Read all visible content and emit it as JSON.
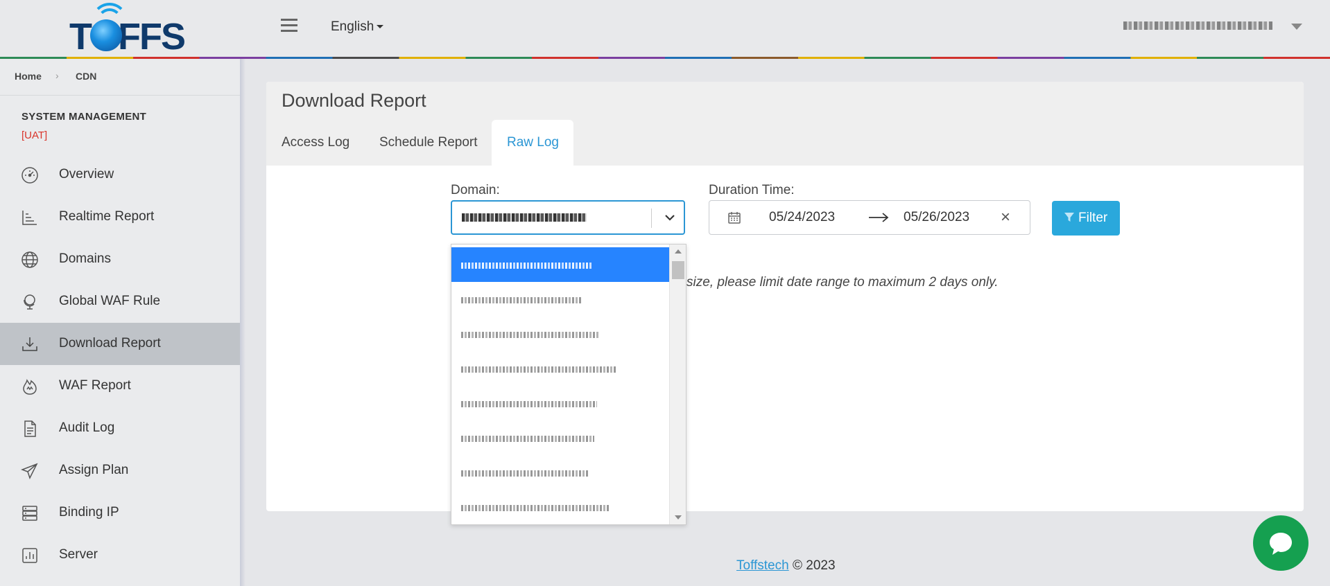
{
  "header": {
    "logo_text": "TOFFS",
    "language": "English"
  },
  "breadcrumb": {
    "home": "Home",
    "current": "CDN"
  },
  "sidebar": {
    "title": "SYSTEM MANAGEMENT",
    "env": "[UAT]",
    "items": [
      {
        "label": "Overview",
        "icon": "gauge-icon"
      },
      {
        "label": "Realtime Report",
        "icon": "bar-chart-icon"
      },
      {
        "label": "Domains",
        "icon": "globe-icon"
      },
      {
        "label": "Global WAF Rule",
        "icon": "globe-stand-icon"
      },
      {
        "label": "Download Report",
        "icon": "download-icon"
      },
      {
        "label": "WAF Report",
        "icon": "flame-icon"
      },
      {
        "label": "Audit Log",
        "icon": "document-icon"
      },
      {
        "label": "Assign Plan",
        "icon": "paper-plane-icon"
      },
      {
        "label": "Binding IP",
        "icon": "server-rack-icon"
      },
      {
        "label": "Server",
        "icon": "analytics-icon"
      }
    ],
    "active_index": 4
  },
  "main": {
    "title": "Download Report",
    "tabs": [
      {
        "label": "Access Log",
        "active": false
      },
      {
        "label": "Schedule Report",
        "active": false
      },
      {
        "label": "Raw Log",
        "active": true
      }
    ],
    "domain_label": "Domain:",
    "duration_label": "Duration Time:",
    "start_date": "05/24/2023",
    "end_date": "05/26/2023",
    "filter_label": "Filter",
    "note": "size, please limit date range to maximum 2 days only."
  },
  "footer": {
    "link": "Toffstech",
    "copyright": "© 2023"
  },
  "colors": {
    "accent": "#2b96d4",
    "filter_button": "#2aa8dc",
    "option_highlight": "#2684ff",
    "env_red": "#d9342b",
    "chat": "#15a050"
  }
}
